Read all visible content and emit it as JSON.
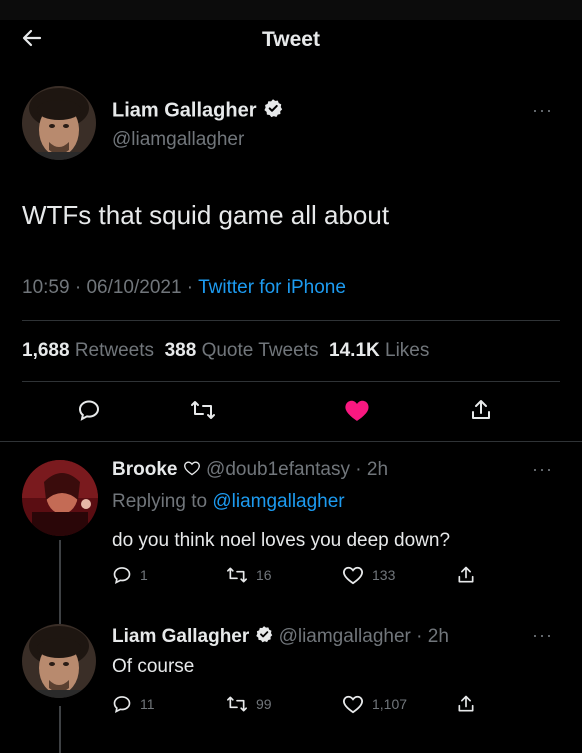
{
  "header": {
    "title": "Tweet"
  },
  "main_tweet": {
    "author_name": "Liam Gallagher",
    "author_handle": "@liamgallagher",
    "text": "WTFs that squid game all about",
    "time": "10:59",
    "date": "06/10/2021",
    "source": "Twitter for iPhone",
    "stats": {
      "retweets_count": "1,688",
      "retweets_label": "Retweets",
      "quotes_count": "388",
      "quotes_label": "Quote Tweets",
      "likes_count": "14.1K",
      "likes_label": "Likes"
    },
    "liked": true
  },
  "replies": [
    {
      "author_name": "Brooke",
      "author_handle": "@doub1efantasy",
      "time": "2h",
      "replying_prefix": "Replying to",
      "replying_to": "@liamgallagher",
      "text": "do you think noel loves you deep down?",
      "reply_count": "1",
      "retweet_count": "16",
      "like_count": "133"
    },
    {
      "author_name": "Liam Gallagher",
      "author_handle": "@liamgallagher",
      "time": "2h",
      "text": "Of course",
      "reply_count": "11",
      "retweet_count": "99",
      "like_count": "1,107"
    }
  ],
  "colors": {
    "background": "#000000",
    "text": "#e7e9ea",
    "muted": "#71767b",
    "accent": "#1d9bf0",
    "like": "#f91880"
  },
  "icons": [
    "back-arrow-icon",
    "verified-badge-icon",
    "more-icon",
    "reply-icon",
    "retweet-icon",
    "heart-icon",
    "share-icon"
  ]
}
